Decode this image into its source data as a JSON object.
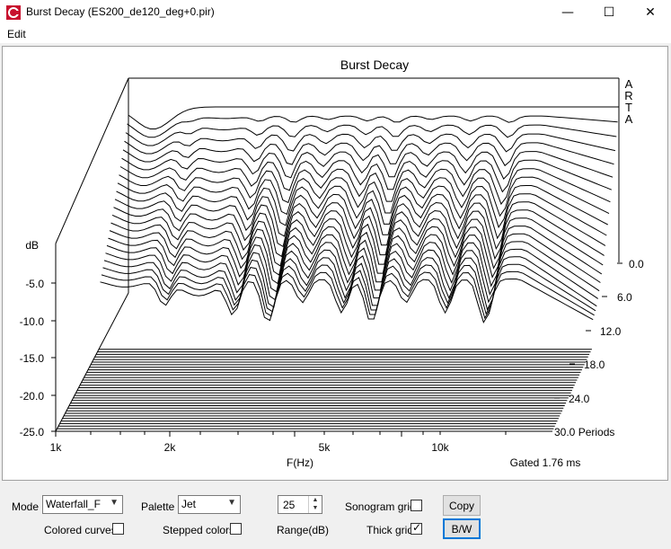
{
  "window": {
    "title": "Burst Decay  (ES200_de120_deg+0.pir)",
    "minimize_glyph": "—",
    "maximize_glyph": "☐",
    "close_glyph": "✕"
  },
  "menu": {
    "edit_label": "Edit"
  },
  "chart": {
    "title": "Burst Decay",
    "watermark": [
      "A",
      "R",
      "T",
      "A"
    ],
    "db_label": "dB",
    "y_ticks": [
      "-5.0",
      "-10.0",
      "-15.0",
      "-20.0",
      "-25.0"
    ],
    "x_ticks": [
      "1k",
      "2k",
      "5k",
      "10k"
    ],
    "xlabel": "F(Hz)",
    "gated_text": "Gated 1.76 ms",
    "depth_ticks": [
      "0.0",
      "6.0",
      "12.0",
      "18.0",
      "24.0",
      "30.0 Periods"
    ]
  },
  "chart_data": {
    "type": "waterfall",
    "title": "Burst Decay",
    "xlabel": "F(Hz)",
    "ylabel": "dB",
    "zlabel": "Periods",
    "x_scale": "log",
    "x_ticks": [
      1000,
      2000,
      5000,
      10000
    ],
    "y_ticks": [
      -5,
      -10,
      -15,
      -20,
      -25
    ],
    "z_ticks": [
      0,
      6,
      12,
      18,
      24,
      30
    ],
    "grid": true,
    "colors": {
      "line": "#000000",
      "background": "#ffffff"
    },
    "annotation": "Gated 1.76 ms"
  },
  "controls": {
    "mode_label": "Mode",
    "mode_value": "Waterfall_F",
    "palette_label": "Palette",
    "palette_value": "Jet",
    "range_value": "25",
    "range_label": "Range(dB)",
    "sonogram_grid_label": "Sonogram grid",
    "sonogram_grid_checked": false,
    "thick_grid_label": "Thick grid",
    "thick_grid_checked": true,
    "colored_curves_label": "Colored curves",
    "colored_curves_checked": false,
    "stepped_colors_label": "Stepped colors",
    "stepped_colors_checked": false,
    "copy_label": "Copy",
    "bw_label": "B/W"
  }
}
